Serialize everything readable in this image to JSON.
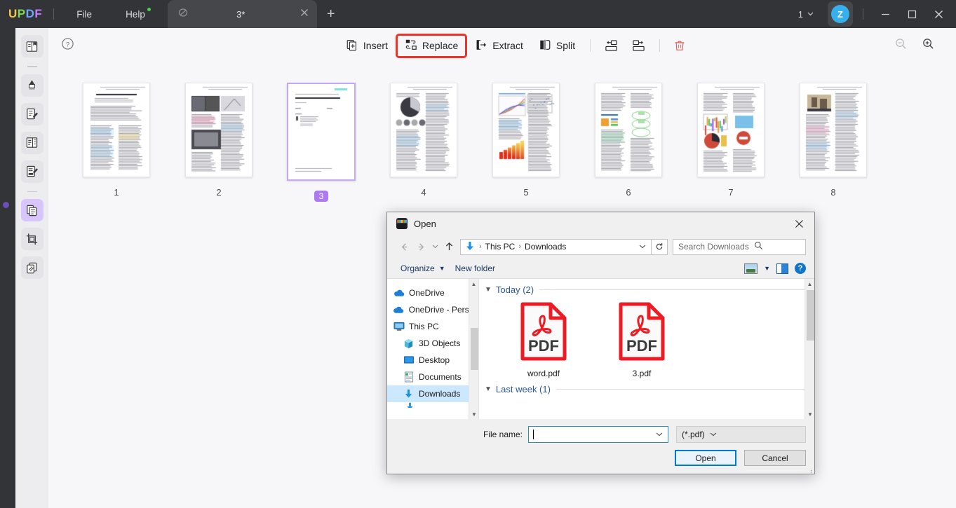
{
  "titlebar": {
    "logo": [
      "U",
      "P",
      "D",
      "F"
    ],
    "menus": [
      {
        "label": "File",
        "badge": false
      },
      {
        "label": "Help",
        "badge": true
      }
    ],
    "tab": {
      "title": "3*",
      "icon": "document-slash-icon",
      "close": "×"
    },
    "new_tab": "+",
    "page_count": "1",
    "avatar_letter": "Z",
    "window_buttons": {
      "minimize": "—",
      "maximize": "□",
      "close": "✕"
    }
  },
  "rail": {
    "items": [
      {
        "name": "reader-icon"
      },
      {
        "name": "separator"
      },
      {
        "name": "highlighter-icon"
      },
      {
        "name": "edit-pdf-icon"
      },
      {
        "name": "comment-icon"
      },
      {
        "name": "form-icon"
      },
      {
        "name": "separator"
      },
      {
        "name": "organize-pages-icon",
        "active": true
      },
      {
        "name": "crop-icon"
      },
      {
        "name": "batch-icon"
      }
    ]
  },
  "toolbar": {
    "help_icon": "question-circle-icon",
    "tools": [
      {
        "label": "Insert",
        "icon": "insert-page-icon",
        "highlight": false
      },
      {
        "label": "Replace",
        "icon": "replace-page-icon",
        "highlight": true
      },
      {
        "label": "Extract",
        "icon": "extract-page-icon",
        "highlight": false
      },
      {
        "label": "Split",
        "icon": "split-page-icon",
        "highlight": false
      }
    ],
    "icon_tools": [
      {
        "name": "merge-left-icon"
      },
      {
        "name": "merge-right-icon"
      },
      {
        "name": "delete-icon"
      }
    ],
    "zoom_out": "zoom-out-icon",
    "zoom_in": "zoom-in-icon",
    "highlight_color": "#e8352a"
  },
  "pages": {
    "selected_page": 3,
    "thumbnails": [
      {
        "number": "1",
        "kind": "text"
      },
      {
        "number": "2",
        "kind": "figures"
      },
      {
        "number": "3",
        "kind": "cover"
      },
      {
        "number": "4",
        "kind": "pie"
      },
      {
        "number": "5",
        "kind": "charts"
      },
      {
        "number": "6",
        "kind": "diagram"
      },
      {
        "number": "7",
        "kind": "mixed"
      },
      {
        "number": "8",
        "kind": "photo"
      }
    ],
    "selected_badge_color": "#ad7bf0"
  },
  "dialog": {
    "title": "Open",
    "icon": "app-icon",
    "close": "✕",
    "nav": {
      "back": "←",
      "forward": "→",
      "recent": "⌄",
      "up": "↑",
      "breadcrumb": [
        "This PC",
        "Downloads"
      ],
      "breadcrumb_icon": "downloads-arrow-icon",
      "dropdown": "⌄",
      "refresh": "↻",
      "search_placeholder": "Search Downloads",
      "search_icon": "search-icon"
    },
    "commands": {
      "organize": "Organize",
      "organize_caret": "▾",
      "new_folder": "New folder",
      "view_icon": "view-mode-icon",
      "view_caret": "▾",
      "pane_icon": "preview-pane-icon",
      "help_icon": "help-icon"
    },
    "sidebar": [
      {
        "label": "OneDrive",
        "icon": "cloud-icon",
        "indent": false,
        "selected": false
      },
      {
        "label": "OneDrive - Person",
        "icon": "cloud-icon",
        "indent": false,
        "selected": false
      },
      {
        "label": "This PC",
        "icon": "computer-icon",
        "indent": false,
        "selected": false
      },
      {
        "label": "3D Objects",
        "icon": "cube-icon",
        "indent": true,
        "selected": false
      },
      {
        "label": "Desktop",
        "icon": "desktop-icon",
        "indent": true,
        "selected": false
      },
      {
        "label": "Documents",
        "icon": "documents-icon",
        "indent": true,
        "selected": false
      },
      {
        "label": "Downloads",
        "icon": "downloads-icon",
        "indent": true,
        "selected": true
      }
    ],
    "groups": [
      {
        "header": "Today (2)",
        "chevron": "⌄",
        "files": [
          {
            "name": "word.pdf",
            "type": "pdf",
            "badge": "PDF"
          },
          {
            "name": "3.pdf",
            "type": "pdf",
            "badge": "PDF"
          }
        ]
      },
      {
        "header": "Last week (1)",
        "chevron": "⌄",
        "files": []
      }
    ],
    "footer": {
      "filename_label": "File name:",
      "filename_value": "",
      "filename_caret": "⌄",
      "filetype_value": "(*.pdf)",
      "filetype_caret": "⌄",
      "open_button": "Open",
      "cancel_button": "Cancel"
    }
  }
}
